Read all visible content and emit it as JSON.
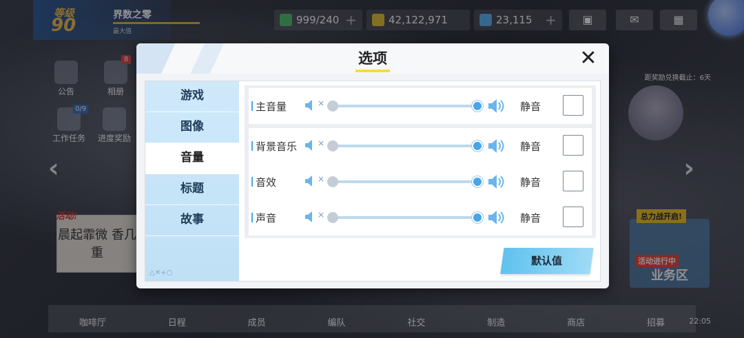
{
  "hud": {
    "level_label": "等级",
    "level_value": "90",
    "player_name": "界数之零",
    "level_sub": "最大值",
    "stamina": "999/240",
    "gold": "42,122,971",
    "gems": "23,115"
  },
  "left_icons": [
    "公告",
    "相册",
    "工作任务",
    "进度奖励"
  ],
  "badges": {
    "album": "8",
    "task": "0/9"
  },
  "poster": {
    "tag": "活动!",
    "text": "晨起霏微 香几重"
  },
  "biz": {
    "top": "总力战开启!",
    "mid": "活动进行中",
    "label": "业务区"
  },
  "deadline": "距奖励兑换截止：6天",
  "bottom_nav": [
    "咖啡厅",
    "日程",
    "成员",
    "编队",
    "社交",
    "制造",
    "商店",
    "招募"
  ],
  "clock": "22:05",
  "dialog": {
    "title": "选项",
    "close": "✕",
    "tabs": [
      {
        "label": "游戏",
        "active": false
      },
      {
        "label": "图像",
        "active": false
      },
      {
        "label": "音量",
        "active": true
      },
      {
        "label": "标题",
        "active": false
      },
      {
        "label": "故事",
        "active": false
      }
    ],
    "side_footer": "△✕+○",
    "rows": [
      {
        "label": "主音量",
        "value": 1.0,
        "mute_label": "静音",
        "muted": false
      },
      {
        "label": "背景音乐",
        "value": 1.0,
        "mute_label": "静音",
        "muted": false
      },
      {
        "label": "音效",
        "value": 1.0,
        "mute_label": "静音",
        "muted": false
      },
      {
        "label": "声音",
        "value": 1.0,
        "mute_label": "静音",
        "muted": false
      }
    ],
    "default_button": "默认值"
  },
  "colors": {
    "accent": "#4aa4e8",
    "tab_bg": "#c9e6f8",
    "title_underline": "#f4dc3a"
  }
}
